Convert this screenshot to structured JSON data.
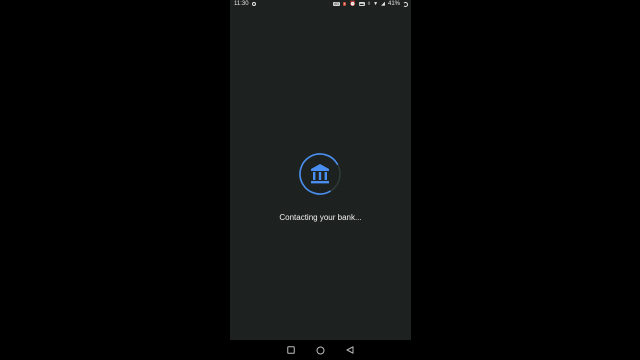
{
  "status_bar": {
    "time": "11:30",
    "network_label": "4G",
    "battery": "41%"
  },
  "main": {
    "message": "Contacting your bank...",
    "icon": "bank-icon",
    "spinner_progress_percent": 75
  },
  "nav": {
    "items": [
      "recents-button",
      "home-button",
      "back-button"
    ]
  },
  "colors": {
    "background": "#1d211f",
    "accent": "#4a8ff0",
    "text": "#f2f2f2"
  }
}
